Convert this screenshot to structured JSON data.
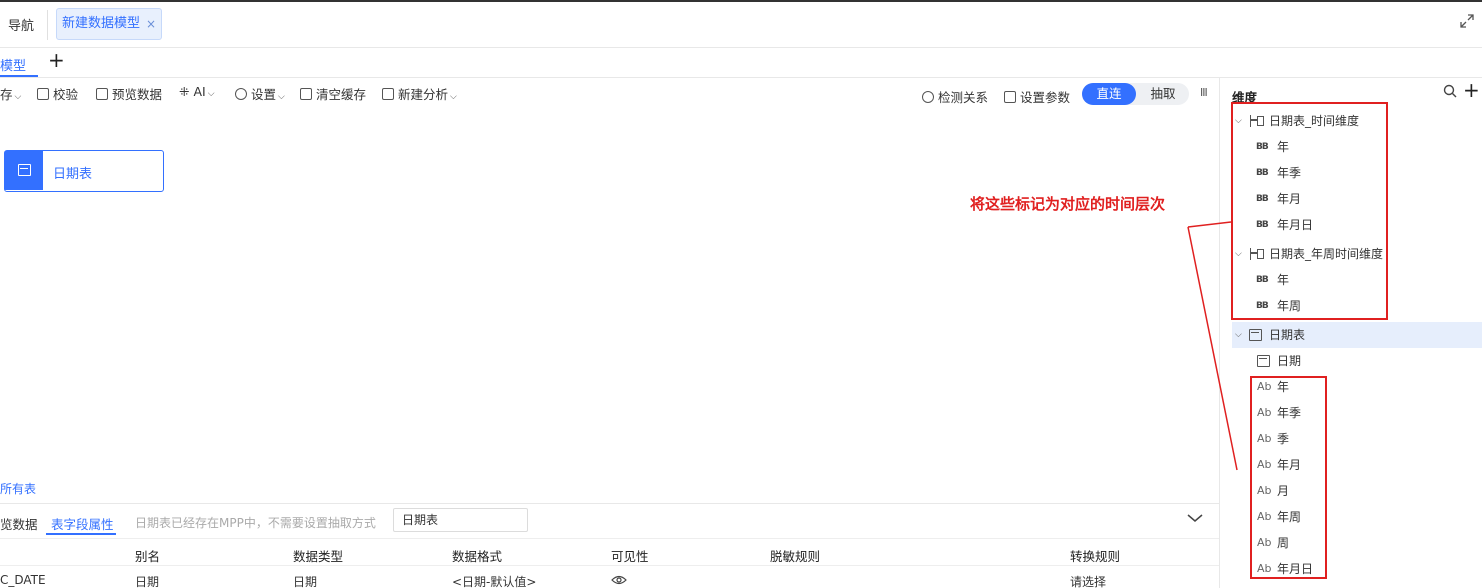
{
  "topbar": {
    "nav_label": "导航",
    "doc_tab_label": "新建数据模型",
    "doc_tab_close": "×"
  },
  "subtabs": {
    "model_label": "模型",
    "add_label": "+"
  },
  "toolbar": {
    "save_label": "存",
    "validate_label": "校验",
    "preview_label": "预览数据",
    "ai_label": "AI",
    "settings_label": "设置",
    "clear_cache_label": "清空缓存",
    "new_analysis_label": "新建分析",
    "detect_relation_label": "检测关系",
    "set_param_label": "设置参数",
    "mode_direct_label": "直连",
    "mode_extract_label": "抽取",
    "columns_toggle": "III"
  },
  "canvas": {
    "table_card_label": "日期表",
    "all_tables_link": "所有表"
  },
  "bottom_panel": {
    "tab_data_label": "览数据",
    "tab_field_props_label": "表字段属性",
    "hint_text": "日期表已经存在MPP中，不需要设置抽取方式",
    "table_select_value": "日期表",
    "columns": {
      "alias": "别名",
      "data_type": "数据类型",
      "data_format": "数据格式",
      "visibility": "可见性",
      "masking_rule": "脱敏规则",
      "convert_rule": "转换规则"
    },
    "row": {
      "field": "C_DATE",
      "alias": "日期",
      "data_type": "日期",
      "data_format": "<日期-默认值>",
      "convert_rule": "请选择"
    }
  },
  "dimension_panel": {
    "title": "维度",
    "hierarchy_time": {
      "label": "日期表_时间维度",
      "levels": [
        "年",
        "年季",
        "年月",
        "年月日"
      ]
    },
    "hierarchy_week": {
      "label": "日期表_年周时间维度",
      "levels": [
        "年",
        "年周"
      ]
    },
    "table": {
      "label": "日期表",
      "date_field": "日期",
      "fields": [
        "年",
        "年季",
        "季",
        "年月",
        "月",
        "年周",
        "周",
        "年月日"
      ]
    }
  },
  "annotation": {
    "text": "将这些标记为对应的时间层次",
    "color": "#e02020"
  },
  "colors": {
    "accent": "#3370ff",
    "annotation_red": "#e02020"
  }
}
